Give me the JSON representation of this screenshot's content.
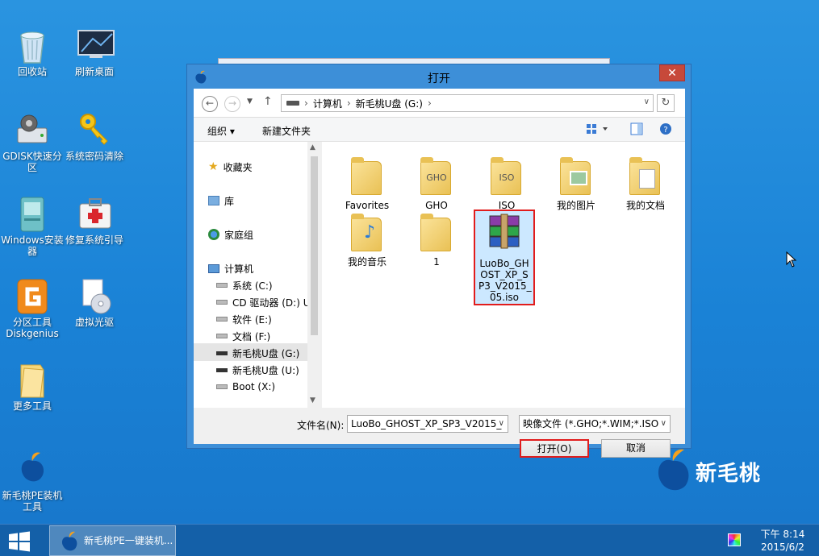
{
  "desktop": {
    "icons": [
      {
        "label": "回收站",
        "icon": "recycle-bin-icon"
      },
      {
        "label": "刷新桌面",
        "icon": "refresh-desktop-icon"
      },
      {
        "label": "GDISK快速分区",
        "icon": "gdisk-icon"
      },
      {
        "label": "系统密码清除",
        "icon": "key-icon"
      },
      {
        "label": "Windows安装器",
        "icon": "windows-installer-icon"
      },
      {
        "label": "修复系统引导",
        "icon": "first-aid-kit-icon"
      },
      {
        "label": "分区工具Diskgenius",
        "icon": "diskgenius-icon"
      },
      {
        "label": "虚拟光驱",
        "icon": "virtual-drive-icon"
      },
      {
        "label": "更多工具",
        "icon": "folder-icon"
      },
      {
        "label": "新毛桃PE装机工具",
        "icon": "xinmaotao-logo-icon"
      }
    ],
    "brand_text": "新毛桃"
  },
  "dialog": {
    "title": "打开",
    "close_label": "✕",
    "breadcrumb": [
      "计算机",
      "新毛桃U盘 (G:)"
    ],
    "toolbar": {
      "organize": "组织 ▾",
      "new_folder": "新建文件夹"
    },
    "nav": {
      "favorites": "收藏夹",
      "libraries": "库",
      "homegroup": "家庭组",
      "computer": "计算机",
      "drives": [
        "系统 (C:)",
        "CD 驱动器 (D:) U",
        "软件 (E:)",
        "文档 (F:)",
        "新毛桃U盘 (G:)",
        "新毛桃U盘 (U:)",
        "Boot (X:)"
      ]
    },
    "files": [
      {
        "name": "Favorites",
        "type": "folder"
      },
      {
        "name": "GHO",
        "type": "disc-gho"
      },
      {
        "name": "ISO",
        "type": "disc-iso"
      },
      {
        "name": "我的图片",
        "type": "folder-pictures"
      },
      {
        "name": "我的文档",
        "type": "folder-documents"
      },
      {
        "name": "我的音乐",
        "type": "folder-music"
      },
      {
        "name": "1",
        "type": "folder"
      },
      {
        "name": "LuoBo_GHOST_XP_SP3_V2015_05.iso",
        "type": "archive",
        "display": "LuoBo_GH OST_XP_S P3_V2015_ 05.iso"
      }
    ],
    "filename_label": "文件名(N):",
    "filename_value": "LuoBo_GHOST_XP_SP3_V2015_",
    "filetype_value": "映像文件 (*.GHO;*.WIM;*.ISO",
    "open_button": "打开(O)",
    "cancel_button": "取消"
  },
  "taskbar": {
    "task_label": "新毛桃PE一键装机...",
    "time": "下午 8:14",
    "date": "2015/6/2"
  },
  "colors": {
    "accent": "#e11c1c",
    "desktop": "#1e88d8",
    "taskbar": "#1460a8"
  }
}
